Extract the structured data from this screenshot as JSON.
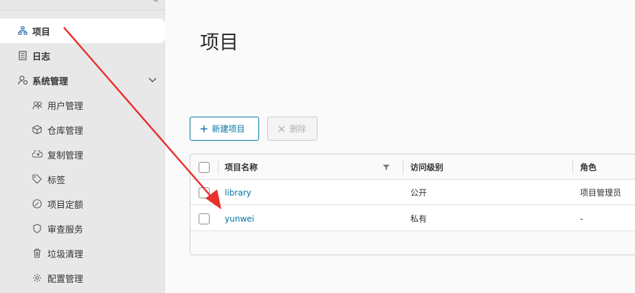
{
  "sidebar": {
    "items": [
      {
        "label": "项目",
        "icon": "project-icon"
      },
      {
        "label": "日志",
        "icon": "log-icon"
      },
      {
        "label": "系统管理",
        "icon": "admin-icon"
      }
    ],
    "sub_items": [
      {
        "label": "用户管理",
        "icon": "users-icon"
      },
      {
        "label": "仓库管理",
        "icon": "registry-icon"
      },
      {
        "label": "复制管理",
        "icon": "replication-icon"
      },
      {
        "label": "标签",
        "icon": "tag-icon"
      },
      {
        "label": "项目定额",
        "icon": "quota-icon"
      },
      {
        "label": "审查服务",
        "icon": "shield-icon"
      },
      {
        "label": "垃圾清理",
        "icon": "trash-icon"
      },
      {
        "label": "配置管理",
        "icon": "gear-icon"
      }
    ]
  },
  "main": {
    "title": "项目",
    "new_button": "新建项目",
    "delete_button": "删除"
  },
  "table": {
    "columns": [
      "项目名称",
      "访问级别",
      "角色"
    ],
    "rows": [
      {
        "name": "library",
        "access": "公开",
        "role": "项目管理员"
      },
      {
        "name": "yunwei",
        "access": "私有",
        "role": "-"
      }
    ]
  },
  "colors": {
    "accent": "#0072a3",
    "annotation_arrow": "#e8302c",
    "sidebar_bg": "#e8e8e8"
  }
}
